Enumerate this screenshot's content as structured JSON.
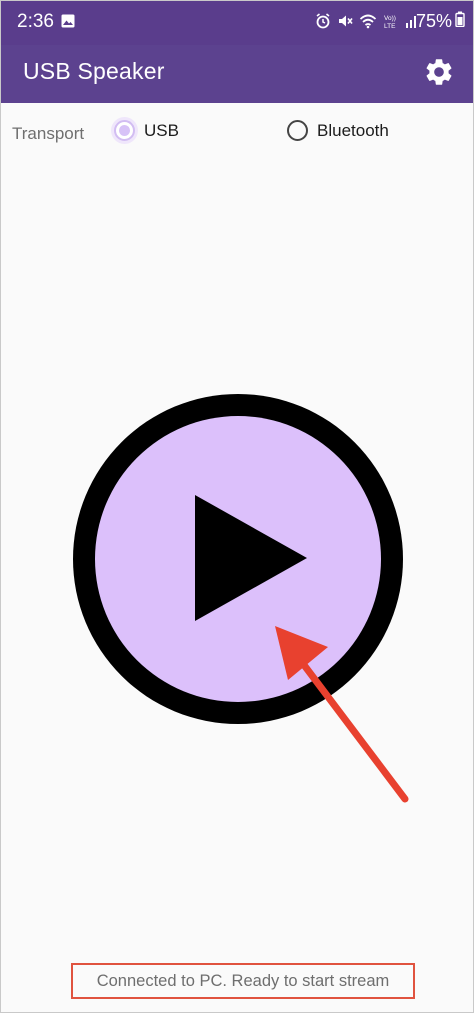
{
  "status_bar": {
    "time": "2:36",
    "battery_percent": "75%",
    "icons": [
      "image-icon",
      "alarm-icon",
      "mute-icon",
      "wifi-icon",
      "volte-icon",
      "signal-icon",
      "battery-icon"
    ]
  },
  "app_bar": {
    "title": "USB Speaker",
    "settings_icon": "gear-icon"
  },
  "transport": {
    "label": "Transport",
    "options": [
      {
        "label": "USB",
        "selected": true
      },
      {
        "label": "Bluetooth",
        "selected": false
      }
    ]
  },
  "play": {
    "icon": "play-icon",
    "fill_color": "#dcc0fb",
    "ring_color": "#000000"
  },
  "annotation": {
    "color": "#e8412f"
  },
  "status": {
    "message": "Connected to PC. Ready to start stream"
  },
  "colors": {
    "header": "#5c428f",
    "accent": "#d7c2f7"
  }
}
